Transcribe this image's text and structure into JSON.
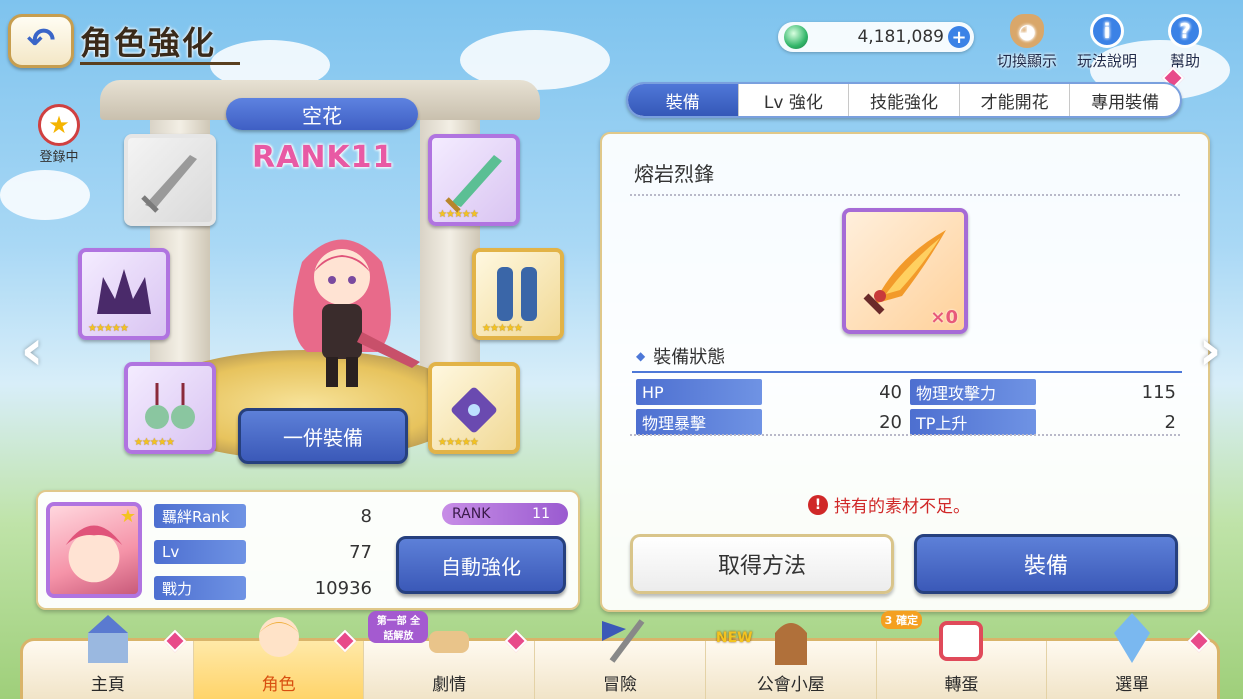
{
  "header": {
    "title": "角色強化"
  },
  "currency": {
    "value": "4,181,089"
  },
  "top_icons": [
    {
      "label": "切換顯示",
      "icon": "mascot-icon"
    },
    {
      "label": "玩法說明",
      "icon": "info-icon"
    },
    {
      "label": "幫助",
      "icon": "help-icon"
    }
  ],
  "registration": {
    "label": "登錄中"
  },
  "character": {
    "name": "空花",
    "rank_label": "RANK11"
  },
  "equip_all_label": "一併裝備",
  "info": {
    "bond_label": "羈絆Rank",
    "bond_value": "8",
    "lv_label": "Lv",
    "lv_value": "77",
    "power_label": "戰力",
    "power_value": "10936",
    "rank_pill_label": "RANK",
    "rank_pill_value": "11",
    "auto_label": "自動強化"
  },
  "tabs": [
    "裝備",
    "Lv 強化",
    "技能強化",
    "才能開花",
    "專用裝備"
  ],
  "item": {
    "name": "熔岩烈鋒",
    "count": "×0",
    "status_title": "裝備狀態",
    "stats": [
      {
        "label": "HP",
        "value": "40"
      },
      {
        "label": "物理攻擊力",
        "value": "115"
      },
      {
        "label": "物理暴擊",
        "value": "20"
      },
      {
        "label": "TP上升",
        "value": "2"
      }
    ],
    "warning": "持有的素材不足。",
    "get_label": "取得方法",
    "equip_label": "裝備"
  },
  "nav": {
    "items": [
      "主頁",
      "角色",
      "劇情",
      "冒險",
      "公會小屋",
      "轉蛋",
      "選單"
    ],
    "story_tag": "第一部 全話解放",
    "new_tag": "NEW",
    "gacha_tag": "3 確定"
  },
  "colors": {
    "accent": "#3b59b8",
    "rank_pink": "#e85aa4",
    "warning": "#d02828"
  }
}
